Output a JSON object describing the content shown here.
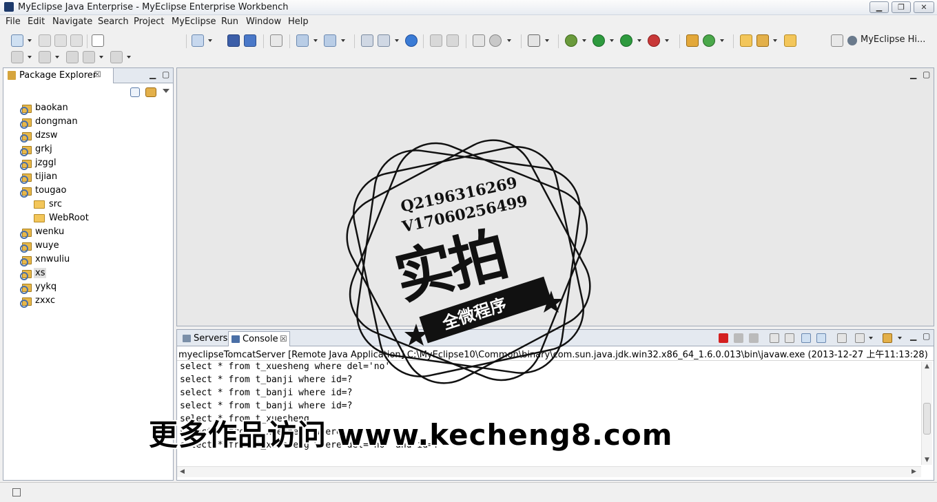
{
  "window": {
    "title": "MyEclipse Java Enterprise - MyEclipse Enterprise Workbench",
    "minimize": "▁",
    "maximize": "❐",
    "close": "✕"
  },
  "menu": [
    "File",
    "Edit",
    "Navigate",
    "Search",
    "Project",
    "MyEclipse",
    "Run",
    "Window",
    "Help"
  ],
  "perspective": {
    "label": "MyEclipse Hi..."
  },
  "package_explorer": {
    "title": "Package Explorer",
    "close": "☒",
    "items": [
      {
        "label": "baokan",
        "type": "project"
      },
      {
        "label": "dongman",
        "type": "project"
      },
      {
        "label": "dzsw",
        "type": "project"
      },
      {
        "label": "grkj",
        "type": "project"
      },
      {
        "label": "jzggl",
        "type": "project"
      },
      {
        "label": "tijian",
        "type": "project"
      },
      {
        "label": "tougao",
        "type": "project"
      },
      {
        "label": "src",
        "type": "package-folder"
      },
      {
        "label": "WebRoot",
        "type": "folder"
      },
      {
        "label": "wenku",
        "type": "project"
      },
      {
        "label": "wuye",
        "type": "project"
      },
      {
        "label": "xnwuliu",
        "type": "project"
      },
      {
        "label": "xs",
        "type": "project",
        "selected": true
      },
      {
        "label": "yykq",
        "type": "project"
      },
      {
        "label": "zxxc",
        "type": "project"
      }
    ]
  },
  "console_panel": {
    "tabs": {
      "servers": "Servers",
      "console": "Console",
      "close": "☒"
    },
    "header": "myeclipseTomcatServer [Remote Java Application] C:\\MyEclipse10\\Common\\binary\\com.sun.java.jdk.win32.x86_64_1.6.0.013\\bin\\javaw.exe (2013-12-27 上午11:13:28)",
    "lines": [
      "select * from t_xuesheng where del='no'",
      "select * from t_banji where id=?",
      "select * from t_banji where id=?",
      "select * from t_banji where id=?",
      "select * from t_xuesheng",
      "select * from t_xuesheng where",
      "select * from t_xuesheng where del='no' and id=?"
    ]
  },
  "watermark": {
    "qq": "Q2196316269",
    "wechat": "V17060256499",
    "big": "实拍",
    "ribbon": "全微程序",
    "site": "更多作品访问 www.kecheng8.com"
  },
  "colors": {
    "accent": "#4a6fa6",
    "stop_button": "#d42020",
    "folder": "#f3c65a"
  }
}
